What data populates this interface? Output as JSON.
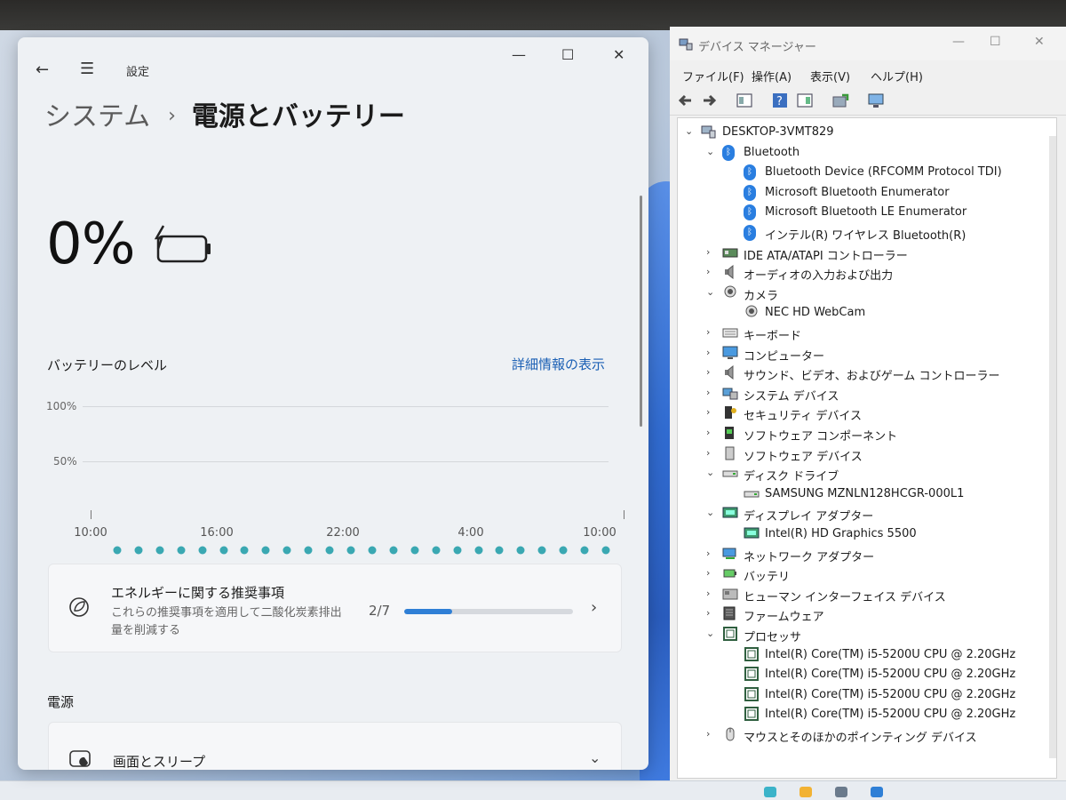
{
  "settings": {
    "app_title": "設定",
    "breadcrumb": {
      "parent": "システム",
      "separator": "›",
      "current": "電源とバッテリー"
    },
    "battery_percent": "0%",
    "battery_level_label": "バッテリーのレベル",
    "detail_link": "詳細情報の表示",
    "recommendation": {
      "title": "エネルギーに関する推奨事項",
      "description": "これらの推奨事項を適用して二酸化炭素排出量を削減する",
      "count": "2/7",
      "progress": 0.2857
    },
    "power_heading": "電源",
    "screen_sleep_label": "画面とスリープ"
  },
  "chart_data": {
    "type": "scatter",
    "title": "バッテリーのレベル",
    "y_ticks": [
      "100%",
      "50%"
    ],
    "x_ticks": [
      "10:00",
      "16:00",
      "22:00",
      "4:00",
      "10:00"
    ],
    "ylim": [
      0,
      100
    ],
    "grid": true,
    "series": [
      {
        "values": [
          0,
          0,
          0,
          0,
          0,
          0,
          0,
          0,
          0,
          0,
          0,
          0,
          0,
          0,
          0,
          0,
          0,
          0,
          0,
          0,
          0,
          0,
          0,
          0
        ]
      }
    ]
  },
  "devmgr": {
    "title": "デバイス マネージャー",
    "menu": [
      "ファイル(F)",
      "操作(A)",
      "表示(V)",
      "ヘルプ(H)"
    ],
    "tree": [
      {
        "label": "DESKTOP-3VMT829",
        "depth": 0,
        "twisty": "⌄",
        "icon": "computer-icon"
      },
      {
        "label": "Bluetooth",
        "depth": 1,
        "twisty": "⌄",
        "icon": "bluetooth-icon"
      },
      {
        "label": "Bluetooth Device (RFCOMM Protocol TDI)",
        "depth": 2,
        "twisty": "",
        "icon": "bluetooth-icon"
      },
      {
        "label": "Microsoft Bluetooth Enumerator",
        "depth": 2,
        "twisty": "",
        "icon": "bluetooth-icon"
      },
      {
        "label": "Microsoft Bluetooth LE Enumerator",
        "depth": 2,
        "twisty": "",
        "icon": "bluetooth-icon"
      },
      {
        "label": "インテル(R) ワイヤレス Bluetooth(R)",
        "depth": 2,
        "twisty": "",
        "icon": "bluetooth-icon"
      },
      {
        "label": "IDE ATA/ATAPI コントローラー",
        "depth": 1,
        "twisty": "›",
        "icon": "ide-controller-icon"
      },
      {
        "label": "オーディオの入力および出力",
        "depth": 1,
        "twisty": "›",
        "icon": "speaker-icon"
      },
      {
        "label": "カメラ",
        "depth": 1,
        "twisty": "⌄",
        "icon": "camera-icon"
      },
      {
        "label": "NEC HD WebCam",
        "depth": 2,
        "twisty": "",
        "icon": "camera-icon"
      },
      {
        "label": "キーボード",
        "depth": 1,
        "twisty": "›",
        "icon": "keyboard-icon"
      },
      {
        "label": "コンピューター",
        "depth": 1,
        "twisty": "›",
        "icon": "monitor-icon"
      },
      {
        "label": "サウンド、ビデオ、およびゲーム コントローラー",
        "depth": 1,
        "twisty": "›",
        "icon": "speaker-icon"
      },
      {
        "label": "システム デバイス",
        "depth": 1,
        "twisty": "›",
        "icon": "system-device-icon"
      },
      {
        "label": "セキュリティ デバイス",
        "depth": 1,
        "twisty": "›",
        "icon": "security-key-icon"
      },
      {
        "label": "ソフトウェア コンポーネント",
        "depth": 1,
        "twisty": "›",
        "icon": "software-component-icon"
      },
      {
        "label": "ソフトウェア デバイス",
        "depth": 1,
        "twisty": "›",
        "icon": "software-device-icon"
      },
      {
        "label": "ディスク ドライブ",
        "depth": 1,
        "twisty": "⌄",
        "icon": "disk-drive-icon"
      },
      {
        "label": "SAMSUNG MZNLN128HCGR-000L1",
        "depth": 2,
        "twisty": "",
        "icon": "disk-drive-icon"
      },
      {
        "label": "ディスプレイ アダプター",
        "depth": 1,
        "twisty": "⌄",
        "icon": "display-adapter-icon"
      },
      {
        "label": "Intel(R) HD Graphics 5500",
        "depth": 2,
        "twisty": "",
        "icon": "display-adapter-icon"
      },
      {
        "label": "ネットワーク アダプター",
        "depth": 1,
        "twisty": "›",
        "icon": "network-adapter-icon"
      },
      {
        "label": "バッテリ",
        "depth": 1,
        "twisty": "›",
        "icon": "battery-icon"
      },
      {
        "label": "ヒューマン インターフェイス デバイス",
        "depth": 1,
        "twisty": "›",
        "icon": "hid-icon"
      },
      {
        "label": "ファームウェア",
        "depth": 1,
        "twisty": "›",
        "icon": "firmware-icon"
      },
      {
        "label": "プロセッサ",
        "depth": 1,
        "twisty": "⌄",
        "icon": "processor-icon"
      },
      {
        "label": "Intel(R) Core(TM) i5-5200U CPU @ 2.20GHz",
        "depth": 2,
        "twisty": "",
        "icon": "processor-icon"
      },
      {
        "label": "Intel(R) Core(TM) i5-5200U CPU @ 2.20GHz",
        "depth": 2,
        "twisty": "",
        "icon": "processor-icon"
      },
      {
        "label": "Intel(R) Core(TM) i5-5200U CPU @ 2.20GHz",
        "depth": 2,
        "twisty": "",
        "icon": "processor-icon"
      },
      {
        "label": "Intel(R) Core(TM) i5-5200U CPU @ 2.20GHz",
        "depth": 2,
        "twisty": "",
        "icon": "processor-icon"
      },
      {
        "label": "マウスとそのほかのポインティング デバイス",
        "depth": 1,
        "twisty": "›",
        "icon": "mouse-icon"
      }
    ]
  },
  "colors": {
    "accent": "#2f7fd6",
    "link": "#1a5fb4",
    "chart_dot": "#3aa8b2"
  }
}
